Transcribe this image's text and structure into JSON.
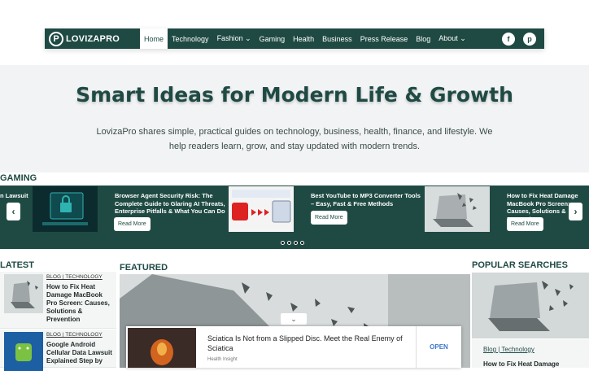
{
  "header": {
    "logo_text": "LOVIZAPRO",
    "logo_letter": "P",
    "menu": [
      {
        "label": "Home"
      },
      {
        "label": "Technology"
      },
      {
        "label": "Fashion ⌄"
      },
      {
        "label": "Gaming"
      },
      {
        "label": "Health"
      },
      {
        "label": "Business"
      },
      {
        "label": "Press Release"
      },
      {
        "label": "Blog"
      },
      {
        "label": "About ⌄"
      }
    ],
    "social": [
      "f",
      "p"
    ]
  },
  "hero": {
    "title": "Smart Ideas for Modern Life & Growth",
    "subtitle": "LovizaPro shares simple, practical guides on technology, business, health, finance, and lifestyle. We help readers learn, grow, and stay updated with modern trends."
  },
  "gaming": {
    "heading": "GAMING",
    "slides": [
      {
        "title": "n Lawsuit"
      },
      {
        "title": "Browser Agent Security Risk: The Complete Guide to Glaring AI Threats, Enterprise Pitfalls & What You Can Do",
        "button": "Read More"
      },
      {
        "title": "Best YouTube to MP3 Converter Tools – Easy, Fast & Free Methods",
        "button": "Read More"
      },
      {
        "title": "How to Fix Heat Damage MacBook Pro Screen: Causes, Solutions & Prevention",
        "button": "Read More"
      }
    ],
    "prev": "‹",
    "next": "›"
  },
  "latest": {
    "heading": "LATEST",
    "items": [
      {
        "cats": "BLOG | TECHNOLOGY",
        "title": "How to Fix Heat Damage MacBook Pro Screen: Causes, Solutions & Prevention"
      },
      {
        "cats": "BLOG | TECHNOLOGY",
        "title": "Google Android Cellular Data Lawsuit Explained Step by"
      }
    ]
  },
  "featured": {
    "heading": "FEATURED",
    "chevron": "⌄"
  },
  "ad": {
    "title": "Sciatica Is Not from a Slipped Disc. Meet the Real Enemy of Sciatica",
    "source": "Health Insight",
    "open_label": "OPEN"
  },
  "popular": {
    "heading": "POPULAR SEARCHES",
    "cats": "Blog | Technology",
    "title": "How to Fix Heat Damage"
  },
  "colors": {
    "brand": "#1f4a44",
    "accent_link": "#3a78c9"
  }
}
